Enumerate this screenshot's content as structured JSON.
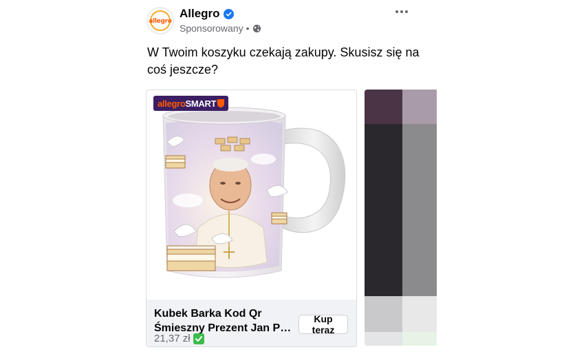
{
  "header": {
    "page_name": "Allegro",
    "avatar_logo_text": "allegro",
    "sponsored_label": "Sponsorowany",
    "separator": "•"
  },
  "post": {
    "text_line1": "W Twoim koszyku czekają zakupy. Skusisz się na",
    "text_line2": "coś jeszcze?"
  },
  "card": {
    "badge_part1": "allegro",
    "badge_part2": "SMART",
    "title_line1": "Kubek Barka Kod Qr",
    "title_line2": "Śmieszny Prezent Jan Paw...",
    "price": "21,37 zł",
    "cta_label": "Kup teraz"
  },
  "colors": {
    "brand_orange": "#ff5a00",
    "smart_purple": "#3b1e63",
    "verified_blue": "#1877f2",
    "secondary_text": "#65676b",
    "footer_bg": "#f0f2f5"
  },
  "icons": {
    "verified": "verified-check-icon",
    "globe": "globe-icon",
    "more": "more-options-icon",
    "price_check": "check-mark-icon"
  }
}
